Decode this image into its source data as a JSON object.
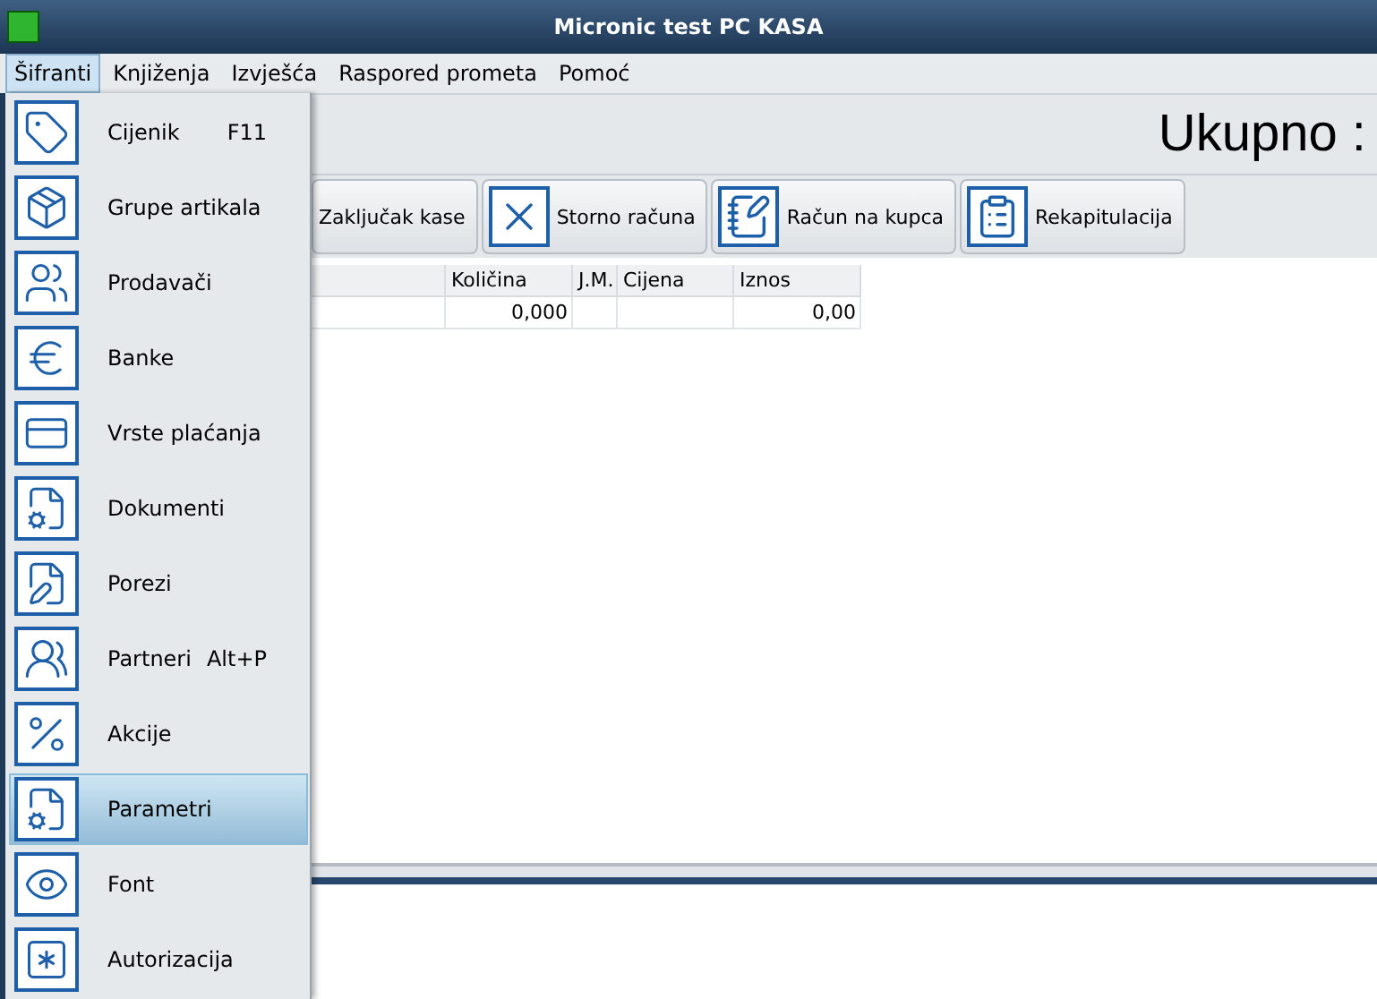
{
  "window": {
    "title": "Micronic test PC KASA"
  },
  "menu_bar": [
    {
      "label": "Šifranti",
      "selected": true
    },
    {
      "label": "Knjiženja",
      "selected": false
    },
    {
      "label": "Izvješća",
      "selected": false
    },
    {
      "label": "Raspored prometa",
      "selected": false
    },
    {
      "label": "Pomoć",
      "selected": false
    }
  ],
  "total_label": "Ukupno :",
  "toolbar": [
    {
      "label": "Zaključak kase",
      "kind": "close"
    },
    {
      "label": "Storno računa",
      "kind": "storno"
    },
    {
      "label": "Račun na kupca",
      "kind": "invoice"
    },
    {
      "label": "Rekapitulacija",
      "kind": "recap"
    }
  ],
  "table": {
    "columns": [
      "Količina",
      "J.M.",
      "Cijena",
      "Iznos"
    ],
    "rows": [
      {
        "cells": [
          "0,000",
          null,
          null,
          "0,00"
        ]
      }
    ]
  },
  "dropdown": [
    {
      "label": "Cijenik",
      "shortcut": "F11",
      "selected": false
    },
    {
      "label": "Grupe artikala",
      "selected": false
    },
    {
      "label": "Prodavači",
      "selected": false
    },
    {
      "label": "Banke",
      "selected": false
    },
    {
      "label": "Vrste plaćanja",
      "selected": false
    },
    {
      "label": "Dokumenti",
      "selected": false
    },
    {
      "label": "Porezi",
      "selected": false
    },
    {
      "label": "Partneri",
      "shortcut": "Alt+P",
      "selected": false
    },
    {
      "label": "Akcije",
      "selected": false
    },
    {
      "label": "Parametri",
      "selected": true
    },
    {
      "label": "Font",
      "selected": false
    },
    {
      "label": "Autorizacija",
      "selected": false
    }
  ]
}
